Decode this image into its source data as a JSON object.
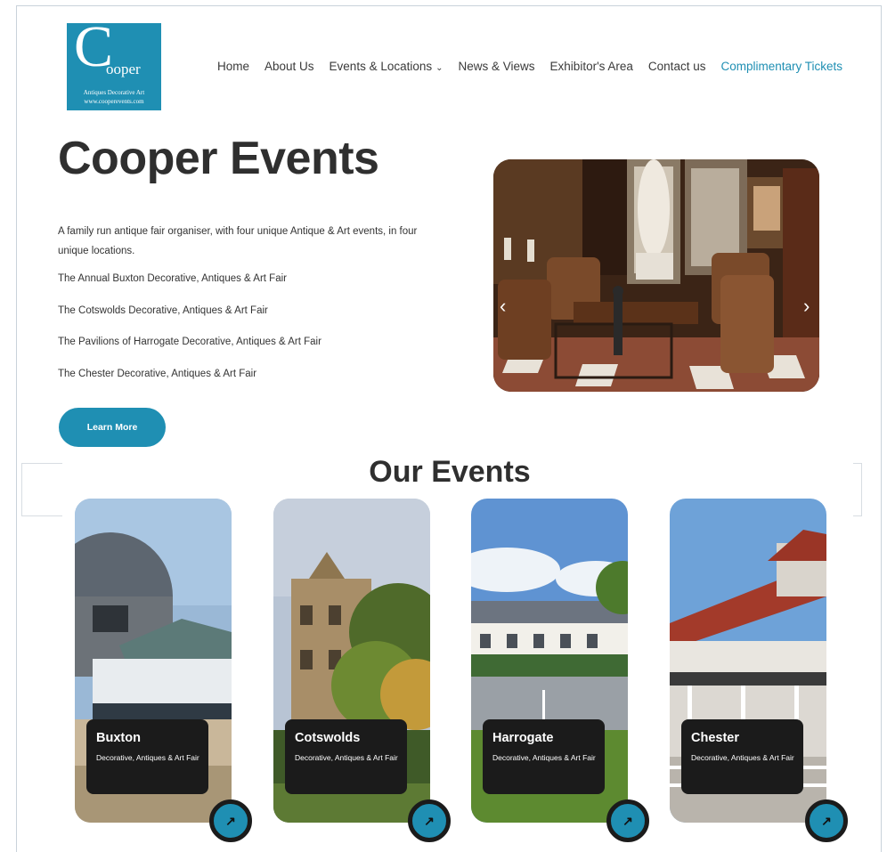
{
  "logo": {
    "big_letter": "C",
    "rest": "ooper",
    "line1": "Antiques Decorative Art",
    "line2": "www.cooperevents.com"
  },
  "nav": {
    "items": [
      "Home",
      "About Us",
      "Events & Locations",
      "News & Views",
      "Exhibitor's Area",
      "Contact us"
    ],
    "highlight": "Complimentary Tickets",
    "dropdown_icon": "chevron-down-icon"
  },
  "hero": {
    "title": "Cooper Events",
    "intro": "A family run antique fair organiser,  with four unique Antique & Art events, in four unique locations.",
    "fairs": [
      "The Annual Buxton Decorative, Antiques & Art Fair",
      "The Cotswolds Decorative, Antiques & Art Fair",
      "The Pavilions of Harrogate Decorative, Antiques & Art Fair",
      "The Chester Decorative, Antiques & Art Fair"
    ],
    "button": "Learn More"
  },
  "slider": {
    "prev_icon": "chevron-left-icon",
    "next_icon": "chevron-right-icon"
  },
  "events": {
    "title": "Our Events",
    "cards": [
      {
        "name": "Buxton",
        "desc": "Decorative, Antiques & Art Fair"
      },
      {
        "name": "Cotswolds",
        "desc": "Decorative, Antiques & Art Fair"
      },
      {
        "name": "Harrogate",
        "desc": "Decorative, Antiques & Art Fair"
      },
      {
        "name": "Chester",
        "desc": "Decorative, Antiques & Art Fair"
      }
    ],
    "card_button_icon": "arrow-up-right-icon"
  },
  "colors": {
    "accent": "#1f8fb3",
    "dark": "#1b1b1b",
    "text": "#2f2f2f"
  }
}
